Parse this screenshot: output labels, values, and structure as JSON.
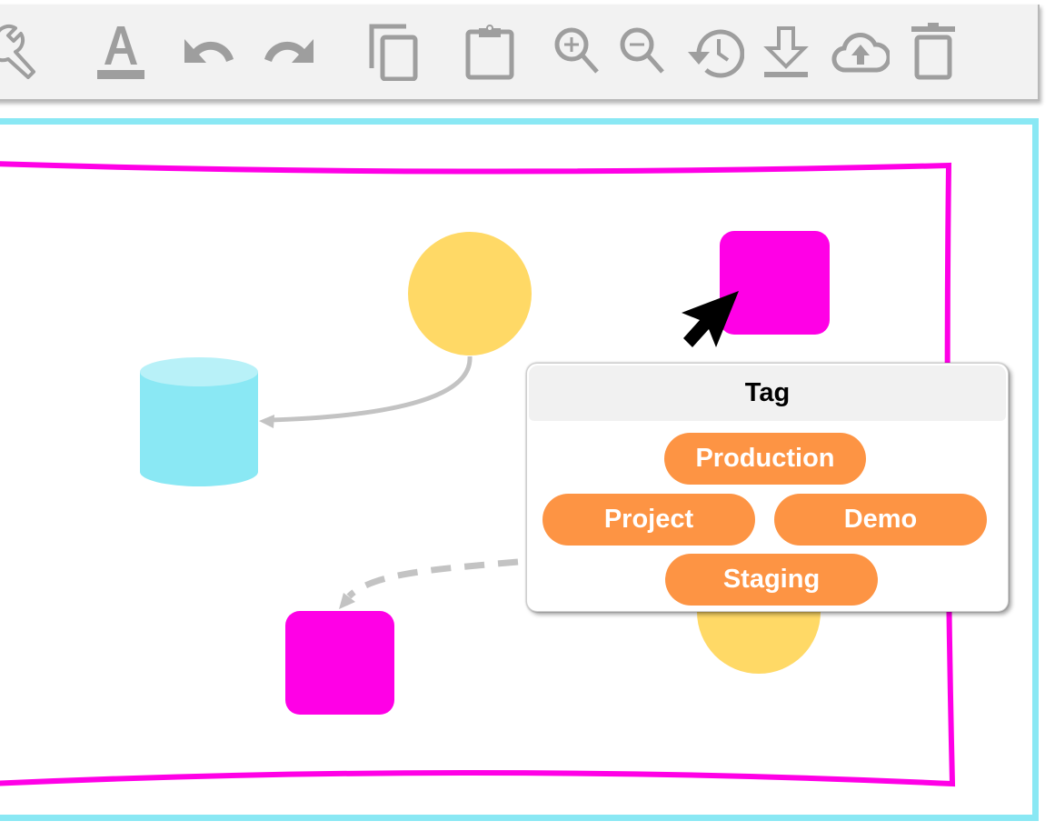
{
  "toolbar": {
    "items": [
      {
        "name": "settings",
        "icon": "wrench-icon"
      },
      {
        "name": "text-format",
        "icon": "font-color-icon"
      },
      {
        "name": "undo",
        "icon": "undo-icon"
      },
      {
        "name": "redo",
        "icon": "redo-icon"
      },
      {
        "name": "copy",
        "icon": "copy-icon"
      },
      {
        "name": "paste",
        "icon": "clipboard-icon"
      },
      {
        "name": "zoom-in",
        "icon": "zoom-in-icon"
      },
      {
        "name": "zoom-out",
        "icon": "zoom-out-icon"
      },
      {
        "name": "history",
        "icon": "history-icon"
      },
      {
        "name": "download",
        "icon": "download-icon"
      },
      {
        "name": "upload",
        "icon": "cloud-upload-icon"
      },
      {
        "name": "delete",
        "icon": "trash-icon"
      }
    ],
    "icon_color": "#9e9e9e"
  },
  "canvas": {
    "border_color": "#8ae8f4",
    "frame_color": "#ff00e6",
    "shapes": [
      {
        "type": "circle",
        "color": "#ffd966",
        "label": ""
      },
      {
        "type": "rounded-square",
        "color": "#ff00e6",
        "label": ""
      },
      {
        "type": "cylinder",
        "color": "#8ae8f4",
        "label": ""
      },
      {
        "type": "rounded-square",
        "color": "#ff00e6",
        "label": ""
      },
      {
        "type": "circle",
        "color": "#ffd966",
        "label": ""
      }
    ],
    "connectors": [
      {
        "from": "circle",
        "to": "cylinder",
        "style": "solid"
      },
      {
        "from": "tag-popup",
        "to": "rounded-square",
        "style": "dashed"
      }
    ]
  },
  "popup": {
    "title": "Tag",
    "chip_color": "#fd9444",
    "tags": [
      "Production",
      "Project",
      "Demo",
      "Staging"
    ]
  }
}
